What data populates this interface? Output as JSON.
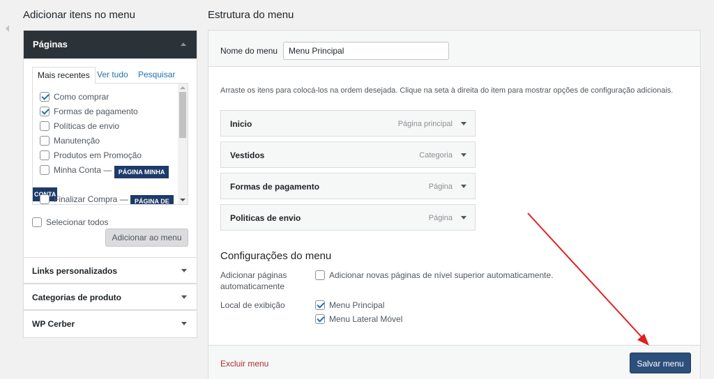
{
  "left": {
    "heading": "Adicionar itens no menu",
    "pages_section": {
      "title": "Páginas",
      "tabs": [
        "Mais recentes",
        "Ver tudo",
        "Pesquisar"
      ],
      "items": [
        {
          "label": "Como comprar",
          "checked": true
        },
        {
          "label": "Formas de pagamento",
          "checked": true
        },
        {
          "label": "Políticas de envio",
          "checked": false
        },
        {
          "label": "Manutenção",
          "checked": false
        },
        {
          "label": "Produtos em Promoção",
          "checked": false
        },
        {
          "label": "Minha Conta —",
          "checked": false,
          "tag": "PÁGINA MINHA",
          "tag_cont": "CONTA"
        },
        {
          "label": "Finalizar Compra —",
          "checked": false,
          "tag": "PÁGINA DE"
        }
      ],
      "select_all": "Selecionar todos",
      "add_button": "Adicionar ao menu"
    },
    "sections": [
      "Links personalizados",
      "Categorias de produto",
      "WP Cerber"
    ]
  },
  "right": {
    "heading": "Estrutura do menu",
    "menu_name_label": "Nome do menu",
    "menu_name_value": "Menu Principal",
    "instructions": "Arraste os itens para colocá-los na ordem desejada. Clique na seta à direita do item para mostrar opções de configuração adicionais.",
    "menu_items": [
      {
        "title": "Inicio",
        "type": "Página principal"
      },
      {
        "title": "Vestidos",
        "type": "Categoria"
      },
      {
        "title": "Formas de pagamento",
        "type": "Página"
      },
      {
        "title": "Politicas de envio",
        "type": "Página"
      }
    ],
    "settings_title": "Configurações do menu",
    "auto_add_label": "Adicionar páginas automaticamente",
    "auto_add_option": "Adicionar novas páginas de nível superior automaticamente.",
    "location_label": "Local de exibição",
    "locations": [
      {
        "label": "Menu Principal",
        "checked": true
      },
      {
        "label": "Menu Lateral Móvel",
        "checked": true
      }
    ],
    "delete_link": "Excluir menu",
    "save_button": "Salvar menu"
  },
  "colors": {
    "accent_dark": "#2c3338",
    "save_button_bg": "#2c4f7c",
    "tag_bg": "#1d3b69",
    "delete_link": "#b32d2e",
    "annotation_arrow": "#e02020"
  }
}
